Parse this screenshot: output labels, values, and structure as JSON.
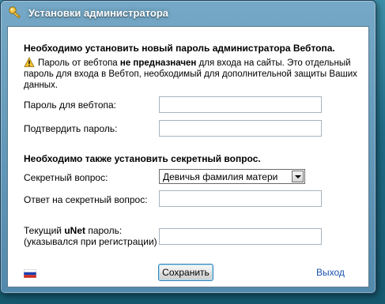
{
  "window": {
    "title": "Установки администратора"
  },
  "section1": {
    "heading": "Необходимо установить новый пароль администратора Вебтопа.",
    "warning_prefix": "Пароль от вебтопа ",
    "warning_bold": "не предназначен",
    "warning_line1_rest": " для входа на сайты. Это отдельный",
    "warning_line2": "пароль для входа в Вебтоп, необходимый для дополнительной защиты Ваших",
    "warning_line3": "данных."
  },
  "fields": {
    "password_label": "Пароль для вебтопа:",
    "confirm_label": "Подтвердить пароль:"
  },
  "section2": {
    "heading": "Необходимо также установить секретный вопрос.",
    "question_label": "Секретный вопрос:",
    "question_selected": "Девичья фамилия матери",
    "answer_label": "Ответ на секретный вопрос:",
    "unet_prefix": "Текущий ",
    "unet_bold": "uNet",
    "unet_suffix": " пароль:",
    "unet_hint": "(указывался при регистрации)"
  },
  "footer": {
    "save_label": "Сохранить",
    "exit_label": "Выход"
  },
  "icons": {
    "title_icon": "key-icon",
    "warning_icon": "warning-icon",
    "flag_icon": "russian-flag-icon"
  }
}
